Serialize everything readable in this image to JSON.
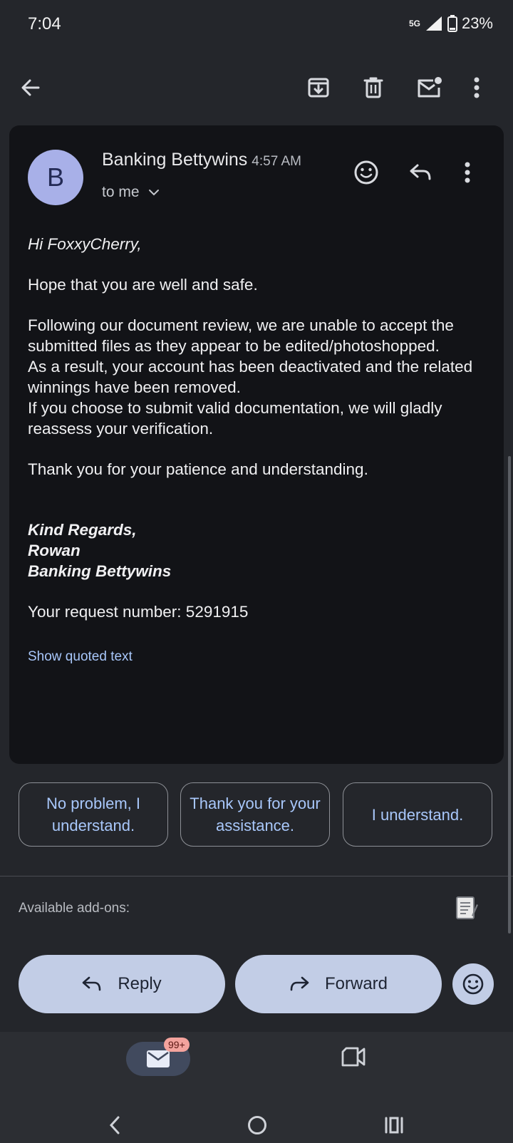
{
  "status": {
    "time": "7:04",
    "network": "5G",
    "battery": "23%"
  },
  "toolbar": {
    "back_icon": "arrow-left-icon",
    "archive_icon": "archive-icon",
    "delete_icon": "trash-icon",
    "unread_icon": "mark-unread-icon",
    "more_icon": "more-vert-icon"
  },
  "email": {
    "avatar_letter": "B",
    "sender": "Banking Bettywins",
    "time": "4:57 AM",
    "to": "to me",
    "greeting": "Hi FoxxyCherry,",
    "p1": "Hope that you are well and safe.",
    "p2a": "Following our document review, we are unable to accept the submitted files as they appear to be edited/photoshopped.",
    "p2b": "As a result, your account has been deactivated and the related winnings have been removed.",
    "p2c": "If you choose to submit valid documentation, we will gladly reassess your verification.",
    "p3": "Thank you for your patience and understanding.",
    "sig1": "Kind Regards,",
    "sig2": "Rowan",
    "sig3": "Banking Bettywins",
    "request": "Your request number: 5291915",
    "show_quoted": "Show quoted text"
  },
  "smart_replies": [
    "No problem, I understand.",
    "Thank you for your assistance.",
    "I understand."
  ],
  "addons": {
    "label": "Available add-ons:"
  },
  "actions": {
    "reply": "Reply",
    "forward": "Forward"
  },
  "nav": {
    "mail_badge": "99+"
  },
  "colors": {
    "accent": "#a8c7fa",
    "pill": "#c2cde6",
    "card": "#121317",
    "background": "#24262b"
  }
}
